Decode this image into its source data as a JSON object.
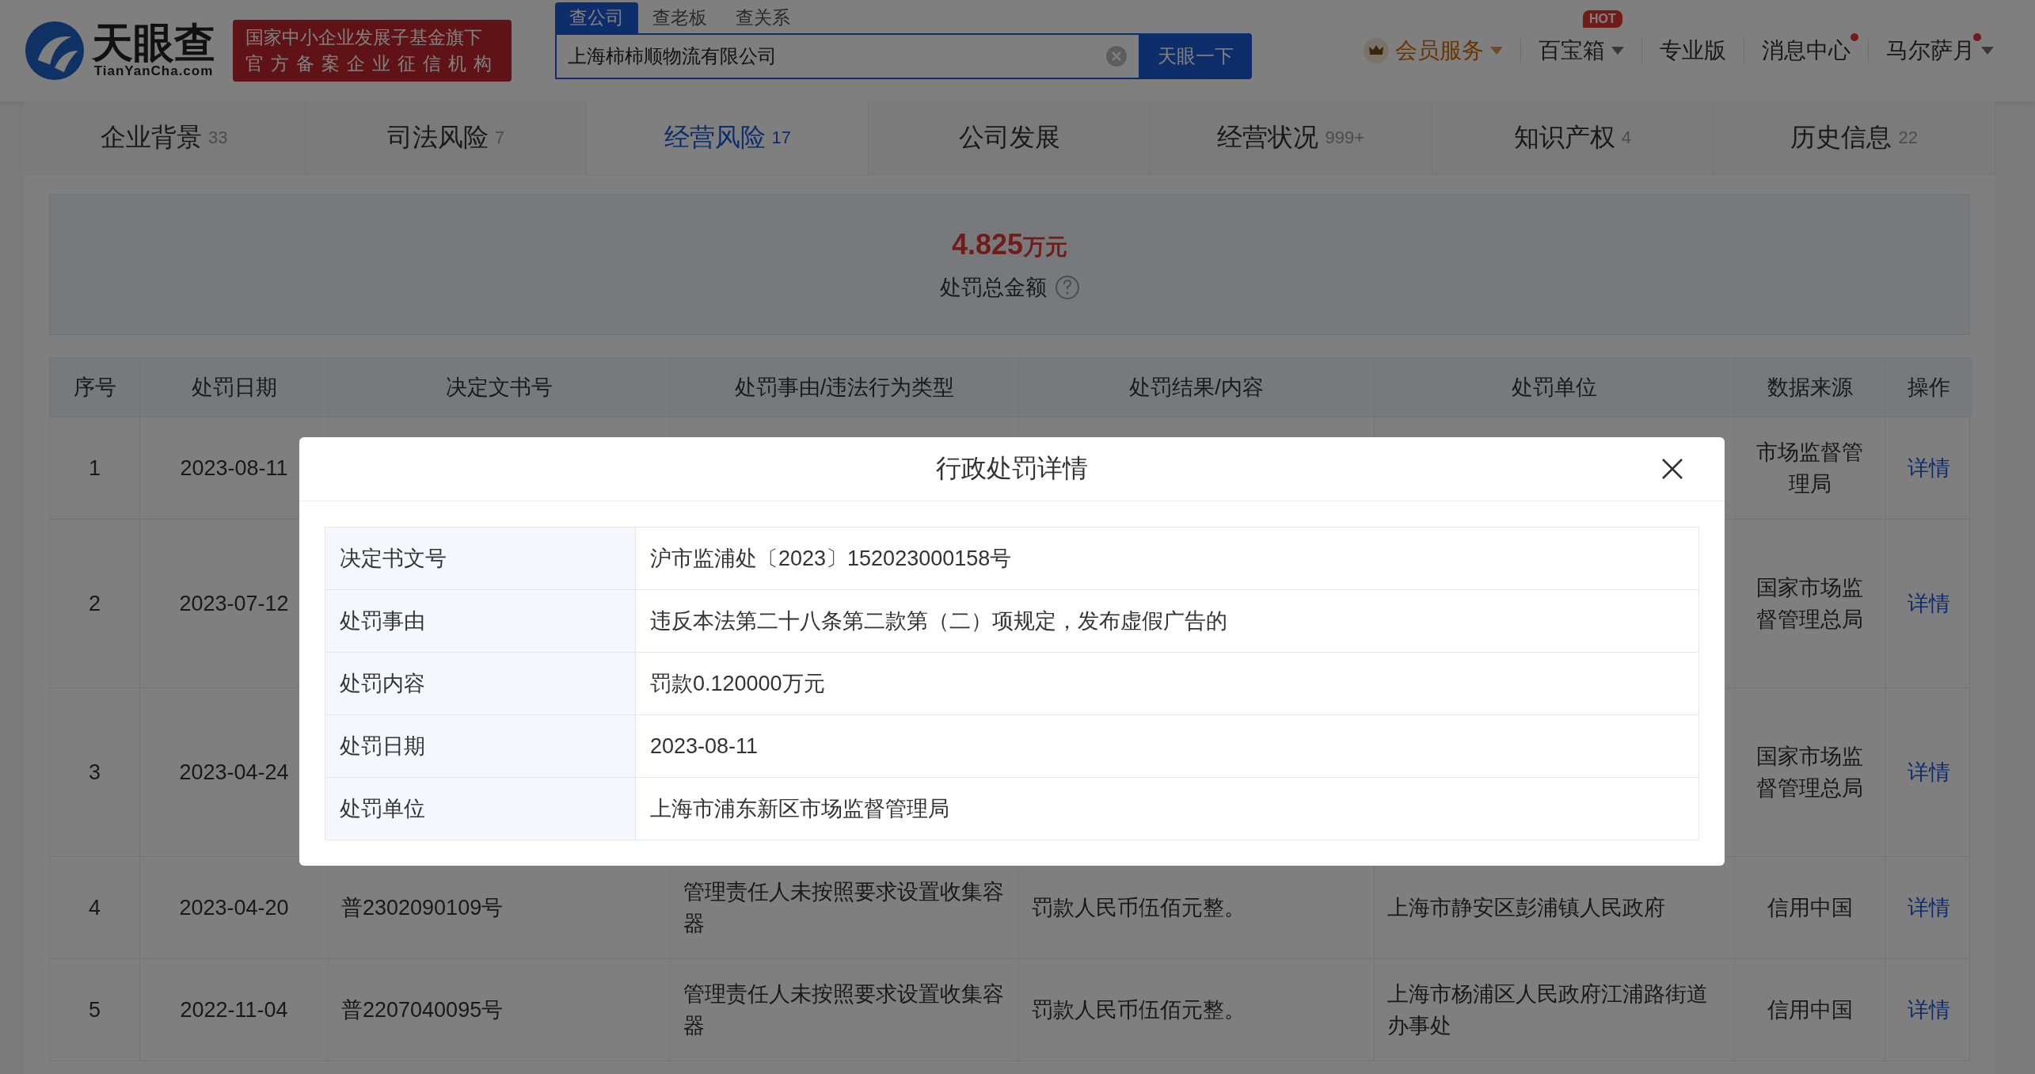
{
  "header": {
    "logo": {
      "name": "天眼查",
      "domain": "TianYanCha.com"
    },
    "badge_lines": [
      "国家中小企业发展子基金旗下",
      "官方备案企业征信机构"
    ],
    "search": {
      "tabs": [
        {
          "label": "查公司",
          "selected": true
        },
        {
          "label": "查老板",
          "selected": false
        },
        {
          "label": "查关系",
          "selected": false
        }
      ],
      "value": "上海柿柿顺物流有限公司",
      "button": "天眼一下"
    },
    "nav": [
      {
        "kind": "member",
        "label": "会员服务",
        "dot": false,
        "caret": true
      },
      {
        "kind": "link",
        "label": "百宝箱",
        "badge": "HOT",
        "dot": false,
        "caret": true
      },
      {
        "kind": "link",
        "label": "专业版",
        "dot": false,
        "caret": false
      },
      {
        "kind": "link",
        "label": "消息中心",
        "dot": true,
        "caret": false
      },
      {
        "kind": "link",
        "label": "马尔萨月",
        "dot": true,
        "caret": true
      }
    ]
  },
  "tabs": [
    {
      "label": "企业背景",
      "count": "33",
      "selected": false
    },
    {
      "label": "司法风险",
      "count": "7",
      "selected": false
    },
    {
      "label": "经营风险",
      "count": "17",
      "selected": true
    },
    {
      "label": "公司发展",
      "selected": false
    },
    {
      "label": "经营状况",
      "count": "999+",
      "selected": false
    },
    {
      "label": "知识产权",
      "count": "4",
      "selected": false
    },
    {
      "label": "历史信息",
      "count": "22",
      "selected": false
    }
  ],
  "summary": {
    "amount": "4.825",
    "unit": "万元",
    "label": "处罚总金额"
  },
  "table": {
    "columns": [
      "序号",
      "处罚日期",
      "决定文书号",
      "处罚事由/违法行为类型",
      "处罚结果/内容",
      "处罚单位",
      "数据来源",
      "操作"
    ],
    "rows": [
      {
        "index": "1",
        "date": "2023-08-11",
        "source": "市场监督管理局",
        "action": "详情"
      },
      {
        "index": "2",
        "date": "2023-07-12",
        "source": "国家市场监督管理总局",
        "action": "详情"
      },
      {
        "index": "3",
        "date": "2023-04-24",
        "source": "国家市场监督管理总局",
        "action": "详情"
      },
      {
        "index": "4",
        "date": "2023-04-20",
        "doc_no": "普2302090109号",
        "reason": "管理责任人未按照要求设置收集容器",
        "result": "罚款人民币伍佰元整。",
        "authority": "上海市静安区彭浦镇人民政府",
        "source": "信用中国",
        "action": "详情"
      },
      {
        "index": "5",
        "date": "2022-11-04",
        "doc_no": "普2207040095号",
        "reason": "管理责任人未按照要求设置收集容器",
        "result": "罚款人民币伍佰元整。",
        "authority": "上海市杨浦区人民政府江浦路街道办事处",
        "source": "信用中国",
        "action": "详情"
      }
    ]
  },
  "modal": {
    "title": "行政处罚详情",
    "fields": [
      {
        "label": "决定书文号",
        "value": "沪市监浦处〔2023〕152023000158号"
      },
      {
        "label": "处罚事由",
        "value": "违反本法第二十八条第二款第（二）项规定，发布虚假广告的"
      },
      {
        "label": "处罚内容",
        "value": "罚款0.120000万元"
      },
      {
        "label": "处罚日期",
        "value": "2023-08-11"
      },
      {
        "label": "处罚单位",
        "value": "上海市浦东新区市场监督管理局"
      }
    ]
  }
}
